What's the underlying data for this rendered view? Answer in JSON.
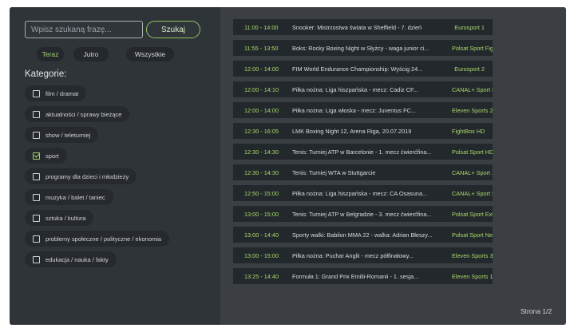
{
  "search": {
    "placeholder": "Wpisz szukaną frazę...",
    "button_label": "Szukaj"
  },
  "filters": [
    {
      "label": "Teraz",
      "active": true
    },
    {
      "label": "Jutro",
      "active": false
    },
    {
      "label": "Wszystkie",
      "active": false
    }
  ],
  "categories": {
    "heading": "Kategorie:",
    "items": [
      {
        "label": "film / dramat",
        "checked": false
      },
      {
        "label": "aktualności / sprawy bieżące",
        "checked": false
      },
      {
        "label": "show / teleturniej",
        "checked": false
      },
      {
        "label": "sport",
        "checked": true
      },
      {
        "label": "programy dla dzieci i młodzieży",
        "checked": false
      },
      {
        "label": "muzyka / balet / taniec",
        "checked": false
      },
      {
        "label": "sztuka / kultura",
        "checked": false
      },
      {
        "label": "problemy społeczne / polityczne / ekonomia",
        "checked": false
      },
      {
        "label": "edukacja / nauka / fakty",
        "checked": false
      }
    ]
  },
  "programs": [
    {
      "time": "11:00 - 14:00",
      "title": "Snooker: Mistrzostwa świata w Sheffield - 7. dzień",
      "channel": "Eurosport 1"
    },
    {
      "time": "11:55 - 13:50",
      "title": "Boks: Rocky Boxing Night w Słyżcy - waga junior ci...",
      "channel": "Polsat Sport Fight..."
    },
    {
      "time": "12:00 - 14:00",
      "title": "FIM World Endurance Championship: Wyścig 24...",
      "channel": "Eurosport 2"
    },
    {
      "time": "12:00 - 14:10",
      "title": "Piłka nożna: Liga hiszpańska - mecz: Cadiz CF...",
      "channel": "CANAL+ Sport HD"
    },
    {
      "time": "12:00 - 14:00",
      "title": "Piłka nożna: Liga włoska - mecz: Juventus FC...",
      "channel": "Eleven Sports 2"
    },
    {
      "time": "12:30 - 16:05",
      "title": "LMK Boxing Night 12, Arena Riga, 20.07.2019",
      "channel": "FightBox HD"
    },
    {
      "time": "12:30 - 14:30",
      "title": "Tenis: Turniej ATP w Barcelonie - 1. mecz ćwierćfina...",
      "channel": "Polsat Sport HD"
    },
    {
      "time": "12:30 - 14:30",
      "title": "Tenis: Turniej WTA w Stuttgarcie",
      "channel": "CANAL+ Sport 2 HD"
    },
    {
      "time": "12:50 - 15:00",
      "title": "Piłka nożna: Liga hiszpańska - mecz: CA Osasuna...",
      "channel": "CANAL+ Sport 5 HD"
    },
    {
      "time": "13:00 - 15:00",
      "title": "Tenis: Turniej ATP w Belgradzie - 3. mecz ćwierćfina...",
      "channel": "Polsat Sport Extra..."
    },
    {
      "time": "13:00 - 14:40",
      "title": "Sporty walki: Babilon MMA 22 - walka: Adrian Błeszy...",
      "channel": "Polsat Sport News..."
    },
    {
      "time": "13:00 - 15:00",
      "title": "Piłka nożna: Puchar Anglii - mecz półfinałowy...",
      "channel": "Eleven Sports 3"
    },
    {
      "time": "13:25 - 14:40",
      "title": "Formuła 1: Grand Prix Emilii-Romanii - 1. sesja...",
      "channel": "Eleven Sports 1"
    }
  ],
  "pagination": {
    "label": "Strona 1/2"
  }
}
